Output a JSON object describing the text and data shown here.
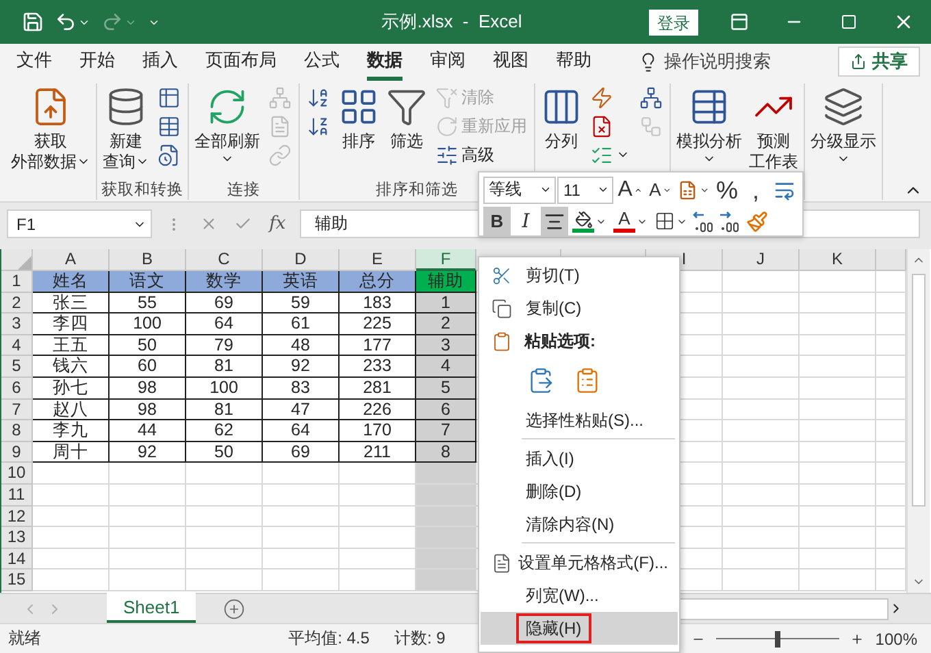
{
  "title_bar": {
    "title": "示例.xlsx  -  Excel",
    "sign_in": "登录"
  },
  "menu_tabs": [
    {
      "label": "文件",
      "selected": false
    },
    {
      "label": "开始",
      "selected": false
    },
    {
      "label": "插入",
      "selected": false
    },
    {
      "label": "页面布局",
      "selected": false
    },
    {
      "label": "公式",
      "selected": false
    },
    {
      "label": "数据",
      "selected": true
    },
    {
      "label": "审阅",
      "selected": false
    },
    {
      "label": "视图",
      "selected": false
    },
    {
      "label": "帮助",
      "selected": false
    }
  ],
  "tell_me": "操作说明搜索",
  "share": "共享",
  "ribbon": {
    "groups": [
      {
        "items": [
          {
            "kind": "large",
            "lines": [
              "获取",
              "外部数据"
            ],
            "dropdown": true
          }
        ]
      },
      {
        "label": "获取和转换",
        "items": [
          {
            "kind": "large",
            "lines": [
              "新建",
              "查询"
            ],
            "dropdown": true
          },
          {
            "kind": "stack",
            "buttons": [
              {
                "disabled": false
              },
              {
                "disabled": false
              },
              {
                "disabled": false
              }
            ]
          }
        ]
      },
      {
        "label": "连接",
        "items": [
          {
            "kind": "large",
            "lines": [
              "全部刷新"
            ],
            "dropdown": true
          },
          {
            "kind": "stack",
            "buttons": [
              {
                "disabled": true
              },
              {
                "disabled": true
              },
              {
                "disabled": true
              }
            ]
          }
        ]
      },
      {
        "label": "排序和筛选",
        "items": [
          {
            "kind": "stack",
            "buttons": [
              {
                "disabled": false
              },
              {
                "disabled": false
              }
            ]
          },
          {
            "kind": "large",
            "lines": [
              "排序"
            ],
            "dropdown": false
          },
          {
            "kind": "large",
            "lines": [
              "筛选"
            ],
            "dropdown": false
          },
          {
            "kind": "stack",
            "buttons": [
              {
                "label": "清除",
                "disabled": true
              },
              {
                "label": "重新应用",
                "disabled": true
              },
              {
                "label": "高级",
                "disabled": false
              }
            ]
          }
        ]
      },
      {
        "items": [
          {
            "kind": "large",
            "lines": [
              "分列"
            ],
            "dropdown": false
          },
          {
            "kind": "stack",
            "buttons": [
              {
                "disabled": false
              },
              {
                "disabled": false
              },
              {
                "disabled": false,
                "dropdown": true
              }
            ]
          },
          {
            "kind": "stack",
            "buttons": [
              {
                "disabled": false
              },
              {
                "disabled": true
              }
            ]
          }
        ]
      },
      {
        "items": [
          {
            "kind": "large",
            "lines": [
              "模拟分析"
            ],
            "dropdown": true
          },
          {
            "kind": "large",
            "lines": [
              "预测",
              "工作表"
            ],
            "dropdown": false
          }
        ]
      },
      {
        "items": [
          {
            "kind": "large",
            "lines": [
              "分级显示"
            ],
            "dropdown": true
          }
        ]
      }
    ]
  },
  "formula_bar": {
    "name_box": "F1",
    "fx": "fx",
    "content": "辅助"
  },
  "sheet": {
    "columns": [
      {
        "label": "A",
        "selected": false
      },
      {
        "label": "B",
        "selected": false
      },
      {
        "label": "C",
        "selected": false
      },
      {
        "label": "D",
        "selected": false
      },
      {
        "label": "E",
        "selected": false
      },
      {
        "label": "F",
        "selected": true
      },
      {
        "selected": false
      },
      {
        "selected": false
      },
      {
        "label": "I",
        "selected": false
      },
      {
        "label": "J",
        "selected": false
      },
      {
        "label": "K",
        "selected": false
      }
    ],
    "rows": [
      {
        "number": "1",
        "kind": "header",
        "cells": [
          "姓名",
          "语文",
          "数学",
          "英语",
          "总分",
          "辅助"
        ]
      },
      {
        "number": "2",
        "kind": "data",
        "cells": [
          "张三",
          "55",
          "69",
          "59",
          "183",
          "1"
        ]
      },
      {
        "number": "3",
        "kind": "data",
        "cells": [
          "李四",
          "100",
          "64",
          "61",
          "225",
          "2"
        ]
      },
      {
        "number": "4",
        "kind": "data",
        "cells": [
          "王五",
          "50",
          "79",
          "48",
          "177",
          "3"
        ]
      },
      {
        "number": "5",
        "kind": "data",
        "cells": [
          "钱六",
          "60",
          "81",
          "92",
          "233",
          "4"
        ]
      },
      {
        "number": "6",
        "kind": "data",
        "cells": [
          "孙七",
          "98",
          "100",
          "83",
          "281",
          "5"
        ]
      },
      {
        "number": "7",
        "kind": "data",
        "cells": [
          "赵八",
          "98",
          "81",
          "47",
          "226",
          "6"
        ]
      },
      {
        "number": "8",
        "kind": "data",
        "cells": [
          "李九",
          "44",
          "62",
          "64",
          "170",
          "7"
        ]
      },
      {
        "number": "9",
        "kind": "data",
        "cells": [
          "周十",
          "92",
          "50",
          "69",
          "211",
          "8"
        ]
      },
      {
        "number": "10",
        "kind": "empty"
      },
      {
        "number": "11",
        "kind": "empty"
      },
      {
        "number": "12",
        "kind": "empty"
      },
      {
        "number": "13",
        "kind": "empty"
      },
      {
        "number": "14",
        "kind": "empty"
      },
      {
        "number": "15",
        "kind": "empty"
      }
    ]
  },
  "sheet_tabs": [
    {
      "label": "Sheet1",
      "selected": true
    }
  ],
  "status_bar": {
    "status": "就绪",
    "average": "平均值: 4.5",
    "count": "计数: 9",
    "zoom": {
      "level": 0.5,
      "reading": "100%"
    }
  },
  "mini_toolbar": {
    "font": "等线",
    "size": "11",
    "row1": [
      {
        "kind": "grow",
        "label": "A"
      },
      {
        "kind": "shrink",
        "label": "A"
      },
      {
        "kind": "format"
      },
      {
        "kind": "text",
        "label": "%"
      },
      {
        "kind": "text",
        "label": ","
      },
      {
        "kind": "wrap"
      }
    ],
    "row2": [
      {
        "kind": "text",
        "label": "B",
        "selected": true
      },
      {
        "kind": "italic",
        "label": "I",
        "selected": false
      },
      {
        "kind": "align",
        "selected": true
      },
      {
        "kind": "fill"
      },
      {
        "kind": "font_color",
        "label": "A"
      },
      {
        "kind": "borders"
      },
      {
        "kind": "inc_decimal"
      },
      {
        "kind": "dec_decimal"
      },
      {
        "kind": "painter"
      }
    ]
  },
  "context_menu": {
    "items": [
      {
        "kind": "command",
        "label": "剪切(T)",
        "selected": false
      },
      {
        "kind": "command",
        "label": "复制(C)",
        "selected": false
      },
      {
        "kind": "heading",
        "label": "粘贴选项:"
      },
      {
        "kind": "paste_icons"
      },
      {
        "kind": "command",
        "label": "选择性粘贴(S)...",
        "selected": false
      },
      {
        "kind": "separator"
      },
      {
        "kind": "command",
        "label": "插入(I)",
        "selected": false
      },
      {
        "kind": "command",
        "label": "删除(D)",
        "selected": false
      },
      {
        "kind": "command",
        "label": "清除内容(N)",
        "selected": false
      },
      {
        "kind": "separator"
      },
      {
        "kind": "command",
        "label": "设置单元格格式(F)...",
        "selected": false
      },
      {
        "kind": "command",
        "label": "列宽(W)...",
        "selected": false
      },
      {
        "kind": "command",
        "label": "隐藏(H)",
        "selected": true
      }
    ]
  }
}
